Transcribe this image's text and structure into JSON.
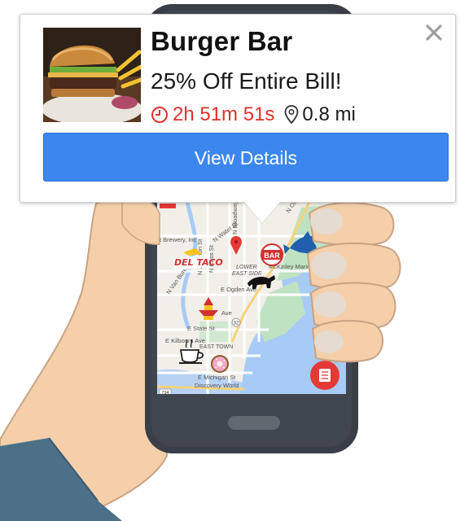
{
  "deal": {
    "name": "Burger Bar",
    "offer": "25% Off Entire Bill!",
    "time_remaining": "2h 51m 51s",
    "distance": "0.8 mi",
    "button_label": "View Details",
    "thumbnail_icon": "burger-photo",
    "timer_icon": "clock-icon",
    "distance_icon": "location-pin-icon",
    "close_icon": "close-icon"
  },
  "map": {
    "labels": {
      "brewery": "t Brewery, Inc",
      "n_water": "N Water St",
      "n_broadway": "N Broadway",
      "e_ogden": "E Ogden Ave",
      "e_state": "E State St",
      "e_kilbourn": "E Kilbourn Ave",
      "east_town": "EAST TOWN",
      "e_michigan": "E Michigan St",
      "discovery": "Discovery World",
      "lower_east_side": "LOWER EAST SIDE",
      "mckinley": "McKinley Marina",
      "n_oakland": "N Oakland Ave",
      "n_cass": "N Cass St",
      "n_jackson": "N Jackson St",
      "n_van_buren": "N Van Buren St",
      "ave": "Ave",
      "route_32": "32",
      "route_794": "794"
    },
    "markers": {
      "deltaco_label": "DEL TACO",
      "bar_label": "BAR"
    }
  },
  "colors": {
    "accent": "#3b87ee",
    "timer": "#e0312d",
    "water": "#a7cbf5",
    "park": "#bfe2c2",
    "fab": "#e53935",
    "skin": "#f5cfaa",
    "sleeve": "#4b7088",
    "phone": "#3a3f47"
  }
}
